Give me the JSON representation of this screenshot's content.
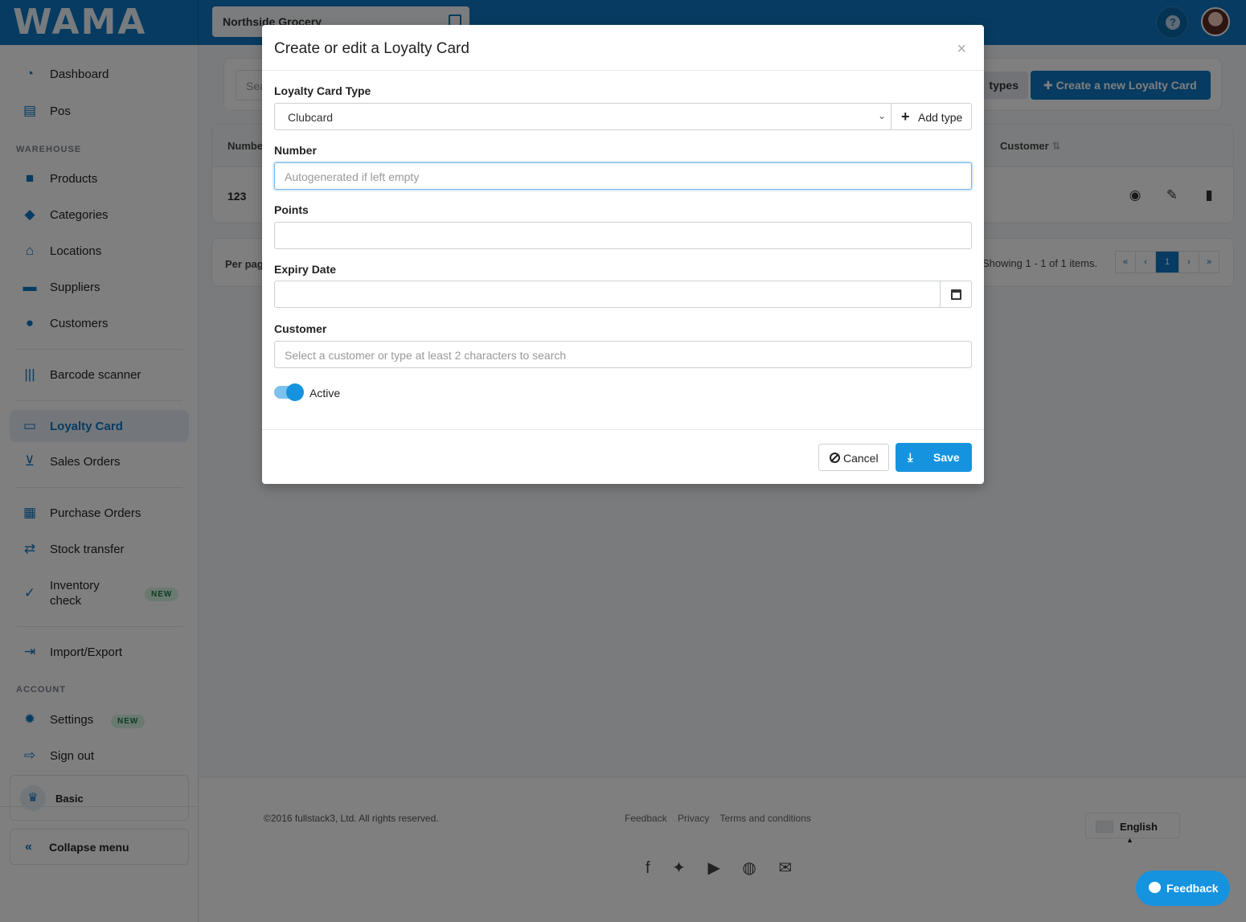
{
  "app": {
    "logo_text": "WAMA",
    "store_name": "Northside Grocery"
  },
  "sidebar": {
    "items": [
      {
        "label": "Dashboard",
        "icon": "gauge-icon"
      },
      {
        "label": "Pos",
        "icon": "cash-register-icon"
      },
      {
        "label": "Products",
        "icon": "box-icon"
      },
      {
        "label": "Categories",
        "icon": "tags-icon"
      },
      {
        "label": "Locations",
        "icon": "warehouse-icon"
      },
      {
        "label": "Suppliers",
        "icon": "truck-icon"
      },
      {
        "label": "Customers",
        "icon": "users-icon"
      },
      {
        "label": "Barcode scanner",
        "icon": "barcode-icon"
      },
      {
        "label": "Loyalty Card",
        "icon": "id-card-icon"
      },
      {
        "label": "Sales Orders",
        "icon": "cart-icon"
      },
      {
        "label": "Purchase Orders",
        "icon": "clipboard-list-icon"
      },
      {
        "label": "Stock transfer",
        "icon": "exchange-icon"
      },
      {
        "label": "Inventory\ncheck",
        "icon": "clipboard-check-icon"
      },
      {
        "label": "Import/Export",
        "icon": "file-export-icon"
      },
      {
        "label": "Settings",
        "icon": "gear-icon"
      },
      {
        "label": "Sign out",
        "icon": "sign-out-icon"
      }
    ],
    "section_warehouse": "WAREHOUSE",
    "section_account": "ACCOUNT",
    "badge_new": "NEW",
    "plan_label": "Basic",
    "collapse_label": "Collapse menu"
  },
  "background": {
    "search_placeholder": "Sea",
    "types_label": "types",
    "create_label": "Create a new Loyalty Card",
    "col_number": "Numbe",
    "col_customer": "Customer",
    "row_number": "123",
    "per_page": "Per pag",
    "showing": "Showing 1 - 1 of 1 items.",
    "pager": [
      "«",
      "‹",
      "1",
      "›",
      "»"
    ]
  },
  "footer": {
    "copyright": "©2016 fullstack3, Ltd. All rights reserved.",
    "links": [
      "Feedback",
      "Privacy",
      "Terms and conditions"
    ],
    "language": "English",
    "feedback_button": "Feedback"
  },
  "modal": {
    "title": "Create or edit a Loyalty Card",
    "close": "×",
    "type_label": "Loyalty Card Type",
    "type_value": "Clubcard",
    "add_type": "Add type",
    "number_label": "Number",
    "number_placeholder": "Autogenerated if left empty",
    "points_label": "Points",
    "points_value": "",
    "expiry_label": "Expiry Date",
    "expiry_value": "",
    "customer_label": "Customer",
    "customer_placeholder": "Select a customer or type at least 2 characters to search",
    "active_label": "Active",
    "active": true,
    "cancel": "Cancel",
    "save": "Save"
  },
  "colors": {
    "primary": "#0e77c2",
    "accent": "#1593df"
  }
}
